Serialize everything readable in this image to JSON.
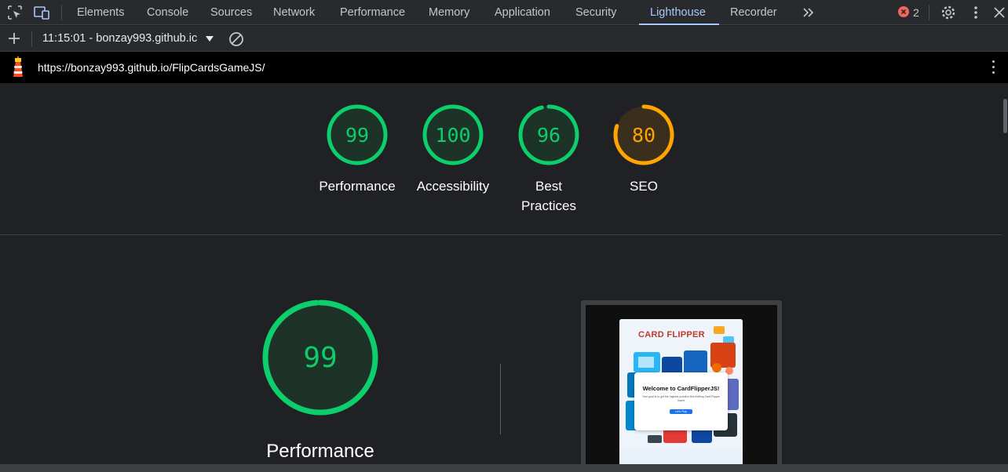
{
  "tabs": {
    "items": [
      {
        "label": "Elements"
      },
      {
        "label": "Console"
      },
      {
        "label": "Sources"
      },
      {
        "label": "Network"
      },
      {
        "label": "Performance"
      },
      {
        "label": "Memory"
      },
      {
        "label": "Application"
      },
      {
        "label": "Security"
      },
      {
        "label": "Lighthouse",
        "active": true
      },
      {
        "label": "Recorder"
      }
    ],
    "error_count": "2"
  },
  "toolbar": {
    "report_label": "11:15:01 - bonzay993.github.ic"
  },
  "urlbar": {
    "url": "https://bonzay993.github.io/FlipCardsGameJS/"
  },
  "scores": [
    {
      "label": "Performance",
      "value": "99",
      "status": "pass"
    },
    {
      "label": "Accessibility",
      "value": "100",
      "status": "pass"
    },
    {
      "label": "Best Practices",
      "value": "96",
      "status": "pass"
    },
    {
      "label": "SEO",
      "value": "80",
      "status": "average"
    }
  ],
  "main": {
    "score": "99",
    "label": "Performance"
  },
  "thumbnail": {
    "title": "CARD FLIPPER",
    "modal_title": "Welcome to CardFlipperJS!",
    "modal_text": "Your goal is to get the highest points in this thrilling Card Flipper Game",
    "modal_button": "Let's Play"
  },
  "colors": {
    "pass": "#0cce6b",
    "average": "#ffa400",
    "active_tab": "#a8c7fa",
    "background": "#202124"
  }
}
